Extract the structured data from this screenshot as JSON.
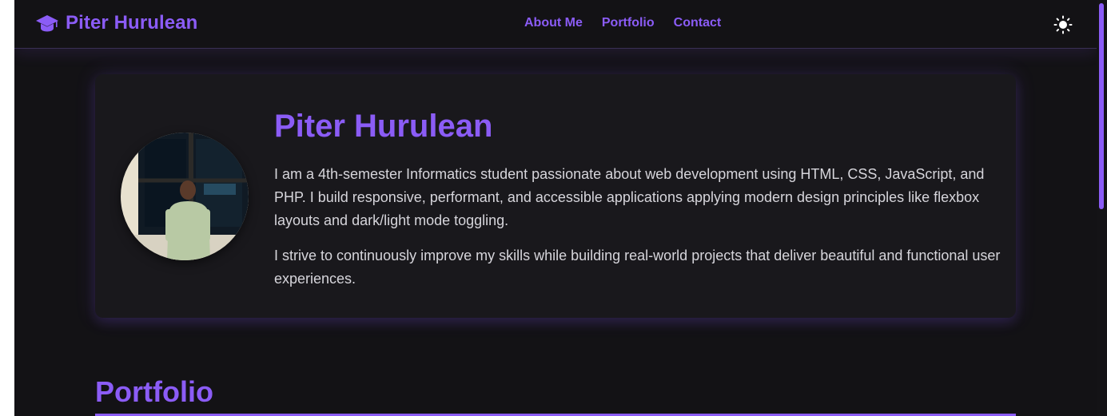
{
  "header": {
    "brand_name": "Piter Hurulean",
    "brand_icon": "graduation-cap-icon",
    "nav": [
      {
        "label": "About Me"
      },
      {
        "label": "Portfolio"
      },
      {
        "label": "Contact"
      }
    ],
    "theme_toggle_icon": "sun-icon"
  },
  "profile": {
    "name": "Piter Hurulean",
    "bio": [
      "I am a 4th-semester Informatics student passionate about web development using HTML, CSS, JavaScript, and PHP. I build responsive, performant, and accessible applications applying modern design principles like flexbox layouts and dark/light mode toggling.",
      "I strive to continuously improve my skills while building real-world projects that deliver beautiful and functional user experiences."
    ]
  },
  "portfolio": {
    "title": "Portfolio"
  },
  "colors": {
    "accent": "#8b5cf6",
    "background": "#131215",
    "card": "#19181c",
    "text": "#d6d5db"
  }
}
